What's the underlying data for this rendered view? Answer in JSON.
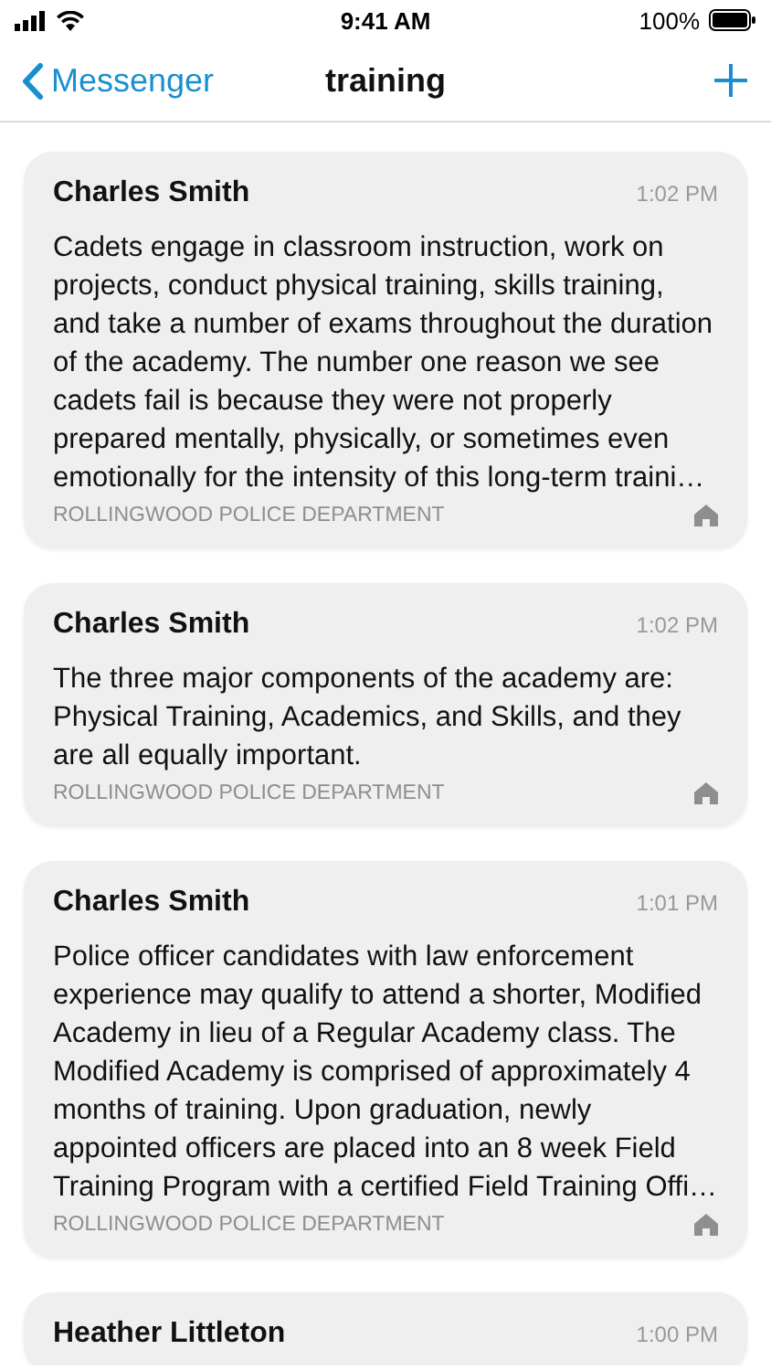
{
  "status_bar": {
    "time": "9:41 AM",
    "battery": "100%"
  },
  "nav": {
    "back": "Messenger",
    "title": "training"
  },
  "messages": [
    {
      "sender": "Charles Smith",
      "time": "1:02 PM",
      "body": "Cadets engage in classroom instruction, work on projects, conduct physical training, skills training, and take a number of exams throughout the duration of the academy. The number one reason we see cadets fail is because they were not properly prepared mentally, physically, or sometimes even emotionally for the intensity of this long-term traini…",
      "source": "ROLLINGWOOD POLICE DEPARTMENT"
    },
    {
      "sender": "Charles Smith",
      "time": "1:02 PM",
      "body": "The three major components of the academy are: Physical Training, Academics, and Skills, and they are all equally important.",
      "source": "ROLLINGWOOD POLICE DEPARTMENT"
    },
    {
      "sender": "Charles Smith",
      "time": "1:01 PM",
      "body": "Police officer candidates with law enforcement experience may qualify to attend a shorter, Modified Academy in lieu of a Regular Academy class. The Modified Academy is comprised of approximately 4 months of training. Upon graduation, newly appointed officers are placed into an 8 week Field Training Program with a certified Field Training Offi…",
      "source": "ROLLINGWOOD POLICE DEPARTMENT"
    },
    {
      "sender": "Heather Littleton",
      "time": "1:00 PM"
    }
  ]
}
